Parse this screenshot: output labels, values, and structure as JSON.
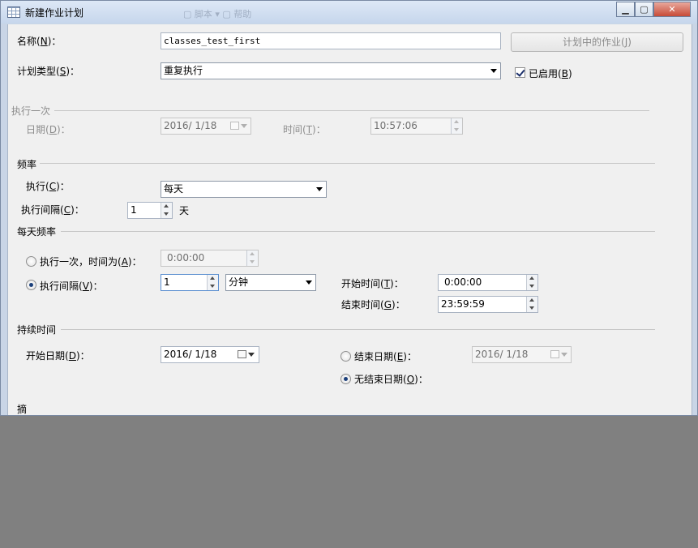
{
  "window": {
    "title": "新建作业计划",
    "ghost_text": "▢ 脚本  ▾  ▢ 帮助",
    "minimize": "▁",
    "maximize": "▢",
    "close": "✕"
  },
  "name": {
    "label": "名称",
    "key": "N",
    "value": "classes_test_first"
  },
  "jobs_button": {
    "label": "计划中的作业",
    "key": "J"
  },
  "schedule_type": {
    "label": "计划类型",
    "key": "S",
    "value": "重复执行"
  },
  "enabled": {
    "label": "已启用",
    "key": "B",
    "checked": true
  },
  "once": {
    "header": "执行一次",
    "date_label": "日期",
    "date_key": "D",
    "date_value": "2016/ 1/18",
    "time_label": "时间",
    "time_key": "T",
    "time_value": "10:57:06"
  },
  "frequency": {
    "header": "频率",
    "occurs_label": "执行",
    "occurs_key": "C",
    "occurs_value": "每天",
    "interval_label": "执行间隔",
    "interval_key": "C",
    "interval_value": "1",
    "interval_unit": "天"
  },
  "daily": {
    "header": "每天频率",
    "once_label": "执行一次，时间为",
    "once_key": "A",
    "once_time": "0:00:00",
    "every_label": "执行间隔",
    "every_key": "V",
    "every_value": "1",
    "every_unit": "分钟",
    "start_label": "开始时间",
    "start_key": "T",
    "start_value": "0:00:00",
    "end_label": "结束时间",
    "end_key": "G",
    "end_value": "23:59:59"
  },
  "duration": {
    "header": "持续时间",
    "start_label": "开始日期",
    "start_key": "D",
    "start_value": "2016/ 1/18",
    "end_label": "结束日期",
    "end_key": "E",
    "end_value": "2016/ 1/18",
    "noend_label": "无结束日期",
    "noend_key": "O"
  },
  "summary": {
    "stub": "摘"
  }
}
